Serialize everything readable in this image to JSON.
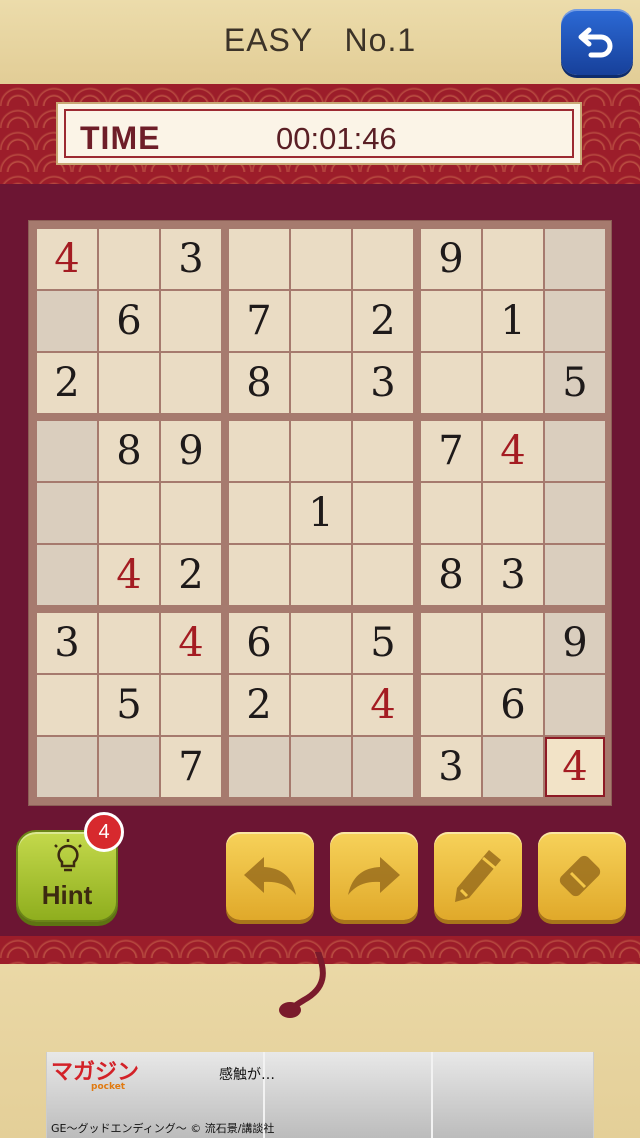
{
  "header": {
    "difficulty": "EASY",
    "puzzle_number": "No.1"
  },
  "timer": {
    "label": "TIME",
    "value": "00:01:46"
  },
  "board": {
    "rows": [
      [
        "4",
        "",
        "3",
        "",
        "",
        "",
        "9",
        "",
        ""
      ],
      [
        "",
        "6",
        "",
        "7",
        "",
        "2",
        "",
        "1",
        ""
      ],
      [
        "2",
        "",
        "",
        "8",
        "",
        "3",
        "",
        "",
        "5"
      ],
      [
        "",
        "8",
        "9",
        "",
        "",
        "",
        "7",
        "4",
        ""
      ],
      [
        "",
        "",
        "",
        "",
        "1",
        "",
        "",
        "",
        ""
      ],
      [
        "",
        "4",
        "2",
        "",
        "",
        "",
        "8",
        "3",
        ""
      ],
      [
        "3",
        "",
        "4",
        "6",
        "",
        "5",
        "",
        "",
        "9"
      ],
      [
        "",
        "5",
        "",
        "2",
        "",
        "4",
        "",
        "6",
        ""
      ],
      [
        "",
        "",
        "7",
        "",
        "",
        "",
        "3",
        "",
        "4"
      ]
    ],
    "user_entered": [
      "0-0",
      "3-7",
      "5-1",
      "6-2",
      "7-5",
      "8-8"
    ],
    "shaded": [
      "0-8",
      "1-0",
      "1-8",
      "2-8",
      "3-0",
      "3-8",
      "4-0",
      "4-8",
      "5-0",
      "5-8",
      "6-8",
      "7-8",
      "8-0",
      "8-1",
      "8-3",
      "8-4",
      "8-5",
      "8-7"
    ],
    "selected": "8-8",
    "colors": {
      "user_digit": "#a41c22",
      "given_digit": "#1e1a1a",
      "frame": "#6c1533"
    }
  },
  "controls": {
    "hint_label": "Hint",
    "hint_count": "4",
    "icons": [
      "back-arrow-icon",
      "lightbulb-icon",
      "undo-icon",
      "redo-icon",
      "pencil-icon",
      "eraser-icon"
    ]
  },
  "ad": {
    "logo": "マガジン",
    "logo_sub": "pocket",
    "bubble": "感触が…",
    "caption": "GE〜グッドエンディング〜 © 流石景/講談社"
  }
}
